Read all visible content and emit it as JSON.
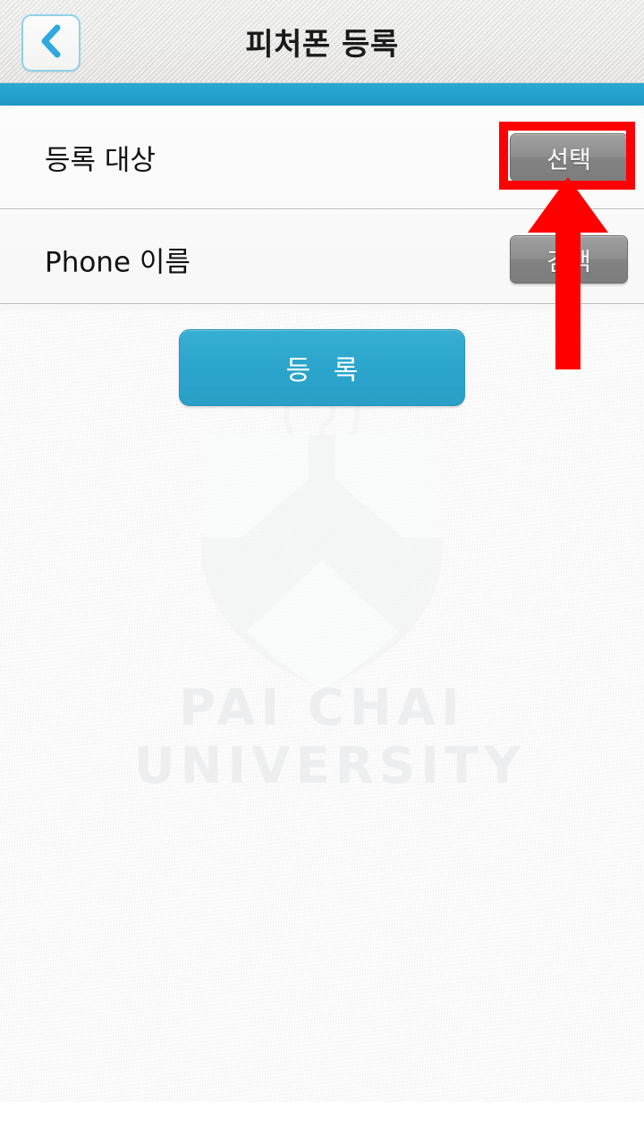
{
  "header": {
    "title": "피처폰 등록",
    "back_icon": "chevron-left-icon"
  },
  "colors": {
    "accent_blue": "#2aa9d3",
    "submit_blue": "#2ba5cc",
    "action_gray": "#8e8e8e",
    "annotation_red": "#fe0000",
    "header_bg": "#e4e4e2",
    "content_bg": "#f6f6f6"
  },
  "form": {
    "rows": [
      {
        "label": "등록 대상",
        "action_label": "선택",
        "action_icon": "select-button"
      },
      {
        "label": "Phone 이름",
        "action_label": "검색",
        "action_icon": "search-button"
      }
    ],
    "submit_label": "등 록"
  },
  "watermark": {
    "logo": "paichai-shield-logo",
    "line1": "PAI CHAI",
    "line2": "UNIVERSITY"
  },
  "annotations": {
    "highlight_target": "선택",
    "arrow_icon": "up-arrow-annotation",
    "box_icon": "red-rectangle-annotation"
  }
}
